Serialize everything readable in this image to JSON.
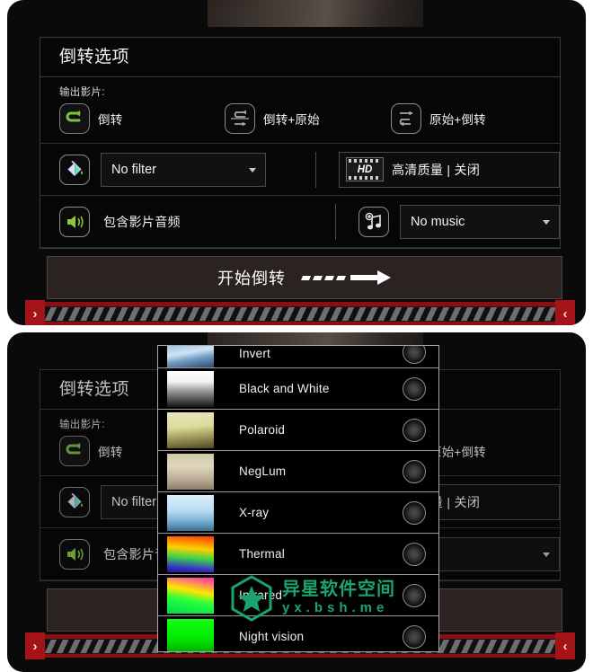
{
  "app": {
    "dialog_title": "倒转选项",
    "section_output_label": "输出影片:"
  },
  "output_modes": [
    {
      "id": "reverse",
      "label": "倒转",
      "icon": "reverse-loop-icon",
      "selected": true
    },
    {
      "id": "reverse_origin",
      "label": "倒转+原始",
      "icon": "reverse-then-forward-icon",
      "selected": false
    },
    {
      "id": "origin_reverse",
      "label": "原始+倒转",
      "icon": "forward-then-reverse-icon",
      "selected": false
    }
  ],
  "filter_row": {
    "icon": "paint-bucket-icon",
    "select_value": "No filter",
    "caret_icon": "chevron-down-icon"
  },
  "hd_row": {
    "icon": "hd-film-icon",
    "badge_text": "HD",
    "label": "高清质量 | 关闭"
  },
  "audio_row": {
    "icon": "speaker-icon",
    "label": "包含影片音频"
  },
  "music_row": {
    "icon": "add-music-icon",
    "select_value": "No music",
    "caret_icon": "chevron-down-icon"
  },
  "start_button": {
    "label": "开始倒转",
    "arrow_icon": "arrow-right-icon"
  },
  "handlebar": {
    "left_tab_icon": "chevron-right-icon",
    "left_tab_glyph": "›",
    "right_tab_icon": "chevron-left-icon",
    "right_tab_glyph": "‹"
  },
  "filter_dropdown": {
    "items": [
      {
        "name": "Invert",
        "thumb": "t-invert",
        "selected": false
      },
      {
        "name": "Black and White",
        "thumb": "t-bw",
        "selected": false
      },
      {
        "name": "Polaroid",
        "thumb": "t-polaroid",
        "selected": false
      },
      {
        "name": "NegLum",
        "thumb": "t-neglum",
        "selected": false
      },
      {
        "name": "X-ray",
        "thumb": "t-xray",
        "selected": false
      },
      {
        "name": "Thermal",
        "thumb": "t-thermal",
        "selected": false
      },
      {
        "name": "Infrared",
        "thumb": "t-infrared",
        "selected": false
      },
      {
        "name": "Night vision",
        "thumb": "t-night",
        "selected": false
      }
    ]
  },
  "watermark": {
    "logo_icon": "hexagon-star-icon",
    "title_cn": "异星软件空间",
    "url": "yx.bsh.me",
    "color": "#19a56c"
  },
  "colors": {
    "accent_green": "#7cc242",
    "panel_bg": "#060606",
    "border": "#3a3a3a",
    "handle_red": "#a31317",
    "start_btn_bg": "#2b2222"
  }
}
